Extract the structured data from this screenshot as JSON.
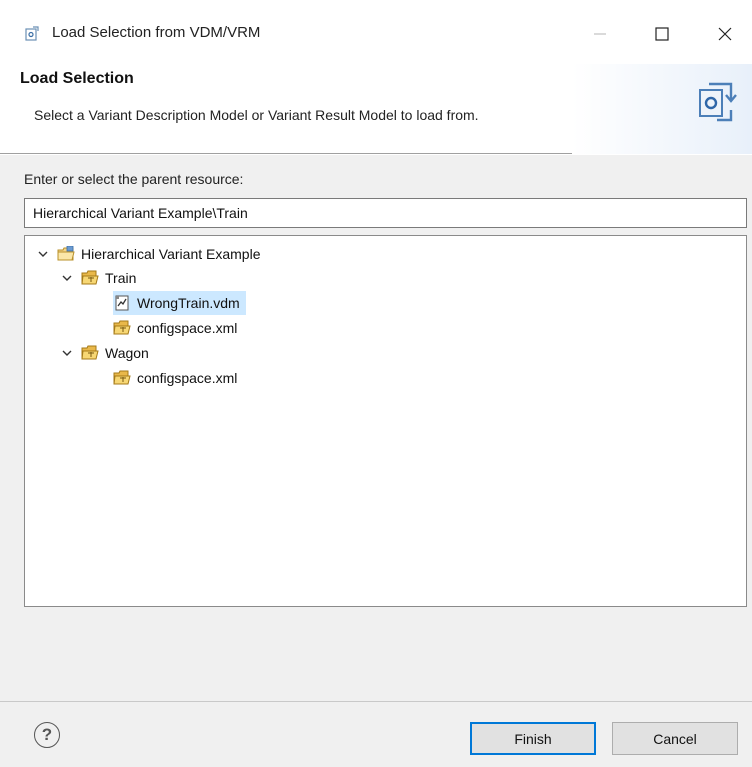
{
  "window": {
    "title": "Load Selection from VDM/VRM",
    "icon": "vdm-load-icon",
    "controls": [
      "minimize",
      "maximize",
      "close"
    ]
  },
  "header": {
    "title": "Load Selection",
    "description": "Select a Variant Description Model or Variant Result Model to load from."
  },
  "form": {
    "parent_label": "Enter or select the parent resource:",
    "parent_value": "Hierarchical Variant Example\\Train"
  },
  "tree": {
    "nodes": [
      {
        "label": "Hierarchical Variant Example",
        "icon": "project-folder-icon",
        "expanded": true,
        "depth": 0
      },
      {
        "label": "Train",
        "icon": "folder-icon",
        "expanded": true,
        "depth": 1
      },
      {
        "label": "WrongTrain.vdm",
        "icon": "vdm-file-icon",
        "selected": true,
        "depth": 2
      },
      {
        "label": "configspace.xml",
        "icon": "configspace-icon",
        "depth": 2
      },
      {
        "label": "Wagon",
        "icon": "folder-icon",
        "expanded": true,
        "depth": 1
      },
      {
        "label": "configspace.xml",
        "icon": "configspace-icon",
        "depth": 2
      }
    ]
  },
  "footer": {
    "help_label": "?",
    "finish_label": "Finish",
    "cancel_label": "Cancel"
  },
  "colors": {
    "selection": "#cce8ff",
    "default_button_border": "#0078d7",
    "dialog_background": "#f0f0f0"
  }
}
